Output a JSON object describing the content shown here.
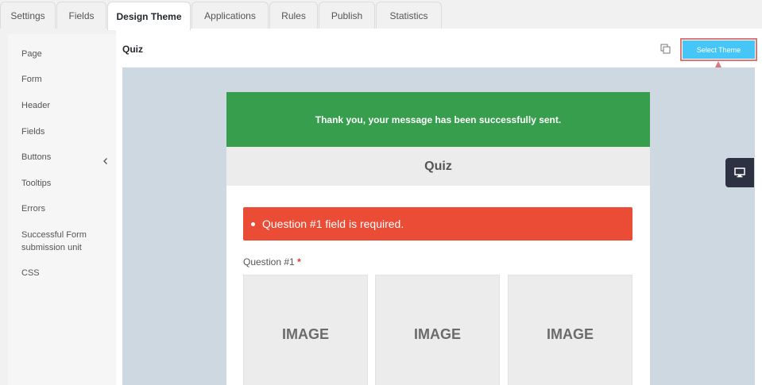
{
  "tabs": [
    {
      "label": "Settings"
    },
    {
      "label": "Fields"
    },
    {
      "label": "Design Theme"
    },
    {
      "label": "Applications"
    },
    {
      "label": "Rules"
    },
    {
      "label": "Publish"
    },
    {
      "label": "Statistics"
    }
  ],
  "active_tab": "Design Theme",
  "sidebar": {
    "items": [
      {
        "label": "Page"
      },
      {
        "label": "Form"
      },
      {
        "label": "Header"
      },
      {
        "label": "Fields"
      },
      {
        "label": "Buttons"
      },
      {
        "label": "Tooltips"
      },
      {
        "label": "Errors"
      },
      {
        "label": "Successful Form submission unit"
      },
      {
        "label": "CSS"
      }
    ]
  },
  "content": {
    "title": "Quiz",
    "select_theme_label": "Select Theme"
  },
  "preview": {
    "success_message": "Thank you, your message has been successfully sent.",
    "form_title": "Quiz",
    "error_message": "Question #1 field is required.",
    "question_label": "Question #1",
    "required_mark": "*",
    "image_options": [
      {
        "label": "IMAGE"
      },
      {
        "label": "IMAGE"
      },
      {
        "label": "IMAGE"
      }
    ]
  },
  "colors": {
    "accent": "#46c5f7",
    "success": "#379e4e",
    "error": "#ea4c35",
    "annotation": "#d9777b",
    "dark": "#2d3142"
  },
  "icons": {
    "copy": "copy-icon",
    "chevron": "chevron-left-icon",
    "monitor": "desktop-monitor-icon"
  }
}
